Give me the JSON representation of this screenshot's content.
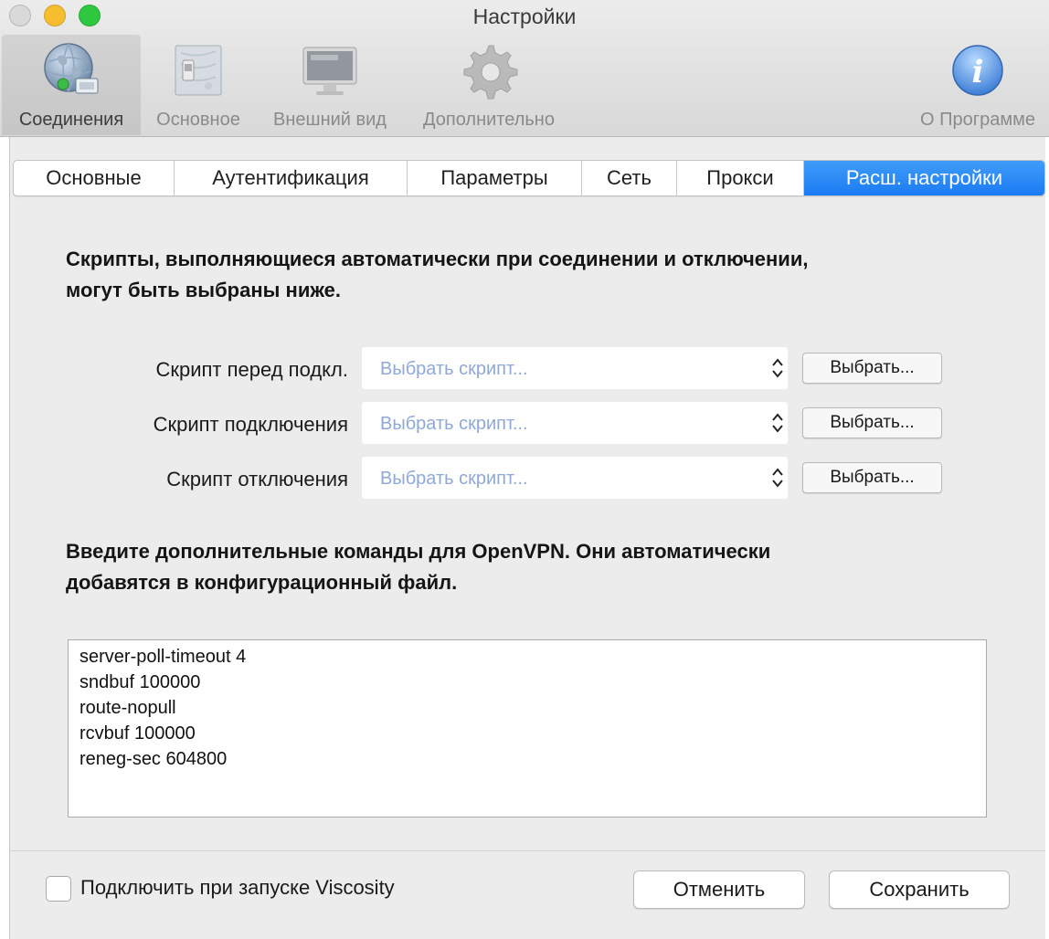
{
  "window": {
    "title": "Настройки"
  },
  "toolbar": {
    "items": [
      {
        "label": "Соединения",
        "icon": "connections-globe-icon"
      },
      {
        "label": "Основное",
        "icon": "general-switch-icon"
      },
      {
        "label": "Внешний вид",
        "icon": "appearance-monitor-icon"
      },
      {
        "label": "Дополнительно",
        "icon": "advanced-gear-icon"
      },
      {
        "label": "О Программе",
        "icon": "info-icon"
      }
    ]
  },
  "tabs": [
    "Основные",
    "Аутентификация",
    "Параметры",
    "Сеть",
    "Прокси",
    "Расш. настройки"
  ],
  "scripts": {
    "heading_line1": "Скрипты, выполняющиеся автоматически при соединении и отключении,",
    "heading_line2": "могут быть выбраны ниже.",
    "rows": [
      {
        "label": "Скрипт перед подкл.",
        "placeholder": "Выбрать скрипт...",
        "button": "Выбрать..."
      },
      {
        "label": "Скрипт подключения",
        "placeholder": "Выбрать скрипт...",
        "button": "Выбрать..."
      },
      {
        "label": "Скрипт отключения",
        "placeholder": "Выбрать скрипт...",
        "button": "Выбрать..."
      }
    ]
  },
  "commands": {
    "heading_line1": "Введите дополнительные команды для OpenVPN. Они автоматически",
    "heading_line2": "добавятся в конфигурационный файл.",
    "lines": [
      "server-poll-timeout 4",
      "sndbuf 100000",
      "route-nopull",
      "rcvbuf 100000",
      "reneg-sec 604800"
    ]
  },
  "footer": {
    "autoconnect_label": "Подключить при запуске Viscosity",
    "autoconnect_checked": false,
    "cancel_label": "Отменить",
    "save_label": "Сохранить"
  },
  "colors": {
    "accent": "#1b7bf3",
    "placeholder": "#8fa8d6",
    "traffic_min": "#f6bd2e",
    "traffic_max": "#2fc73f"
  }
}
